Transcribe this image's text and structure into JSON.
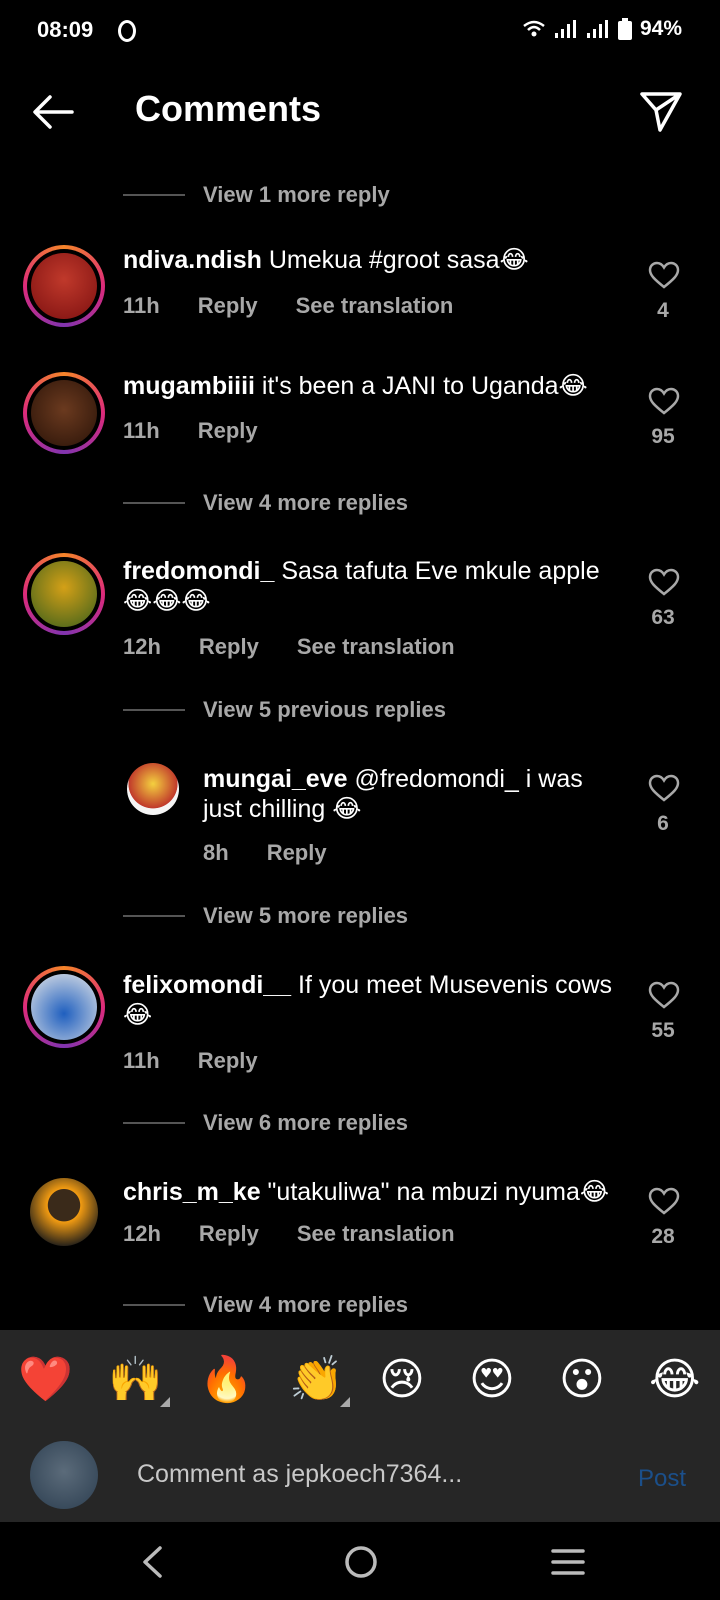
{
  "status": {
    "time": "08:09",
    "battery": "94%"
  },
  "header": {
    "title": "Comments"
  },
  "view_more": [
    "View 1 more reply",
    "View 4 more replies",
    "View 5 previous replies",
    "View 5 more replies",
    "View 6 more replies",
    "View 4 more replies"
  ],
  "comments": [
    {
      "user": "ndiva.ndish",
      "text": " Umekua #groot sasa😂",
      "time": "11h",
      "reply": "Reply",
      "translate": "See translation",
      "likes": "4"
    },
    {
      "user": "mugambiiii",
      "text": " it's been a JANI to Uganda😂",
      "time": "11h",
      "reply": "Reply",
      "likes": "95"
    },
    {
      "user": "fredomondi_",
      "text": " Sasa tafuta Eve mkule apple 😂😂😂",
      "time": "12h",
      "reply": "Reply",
      "translate": "See translation",
      "likes": "63"
    },
    {
      "user": "mungai_eve",
      "text": " @fredomondi_ i was just chilling 😂",
      "time": "8h",
      "reply": "Reply",
      "likes": "6"
    },
    {
      "user": "felixomondi__",
      "text": " If you meet Musevenis cows 😂",
      "time": "11h",
      "reply": "Reply",
      "likes": "55"
    },
    {
      "user": "chris_m_ke",
      "text": " \"utakuliwa\" na mbuzi nyuma😂",
      "time": "12h",
      "reply": "Reply",
      "translate": "See translation",
      "likes": "28"
    }
  ],
  "reactions": [
    "❤️",
    "🙌",
    "🔥",
    "👏",
    "😢",
    "😍",
    "😮",
    "😂"
  ],
  "composer": {
    "placeholder": "Comment as jepkoech7364...",
    "post_label": "Post"
  },
  "icons": [
    "back-arrow-icon",
    "send-icon",
    "heart-icon",
    "nav-back-icon",
    "nav-home-icon",
    "nav-menu-icon"
  ],
  "colors": {
    "background": "#000000",
    "muted_text": "#a8a8a8",
    "post_button": "#1b4f8a"
  }
}
